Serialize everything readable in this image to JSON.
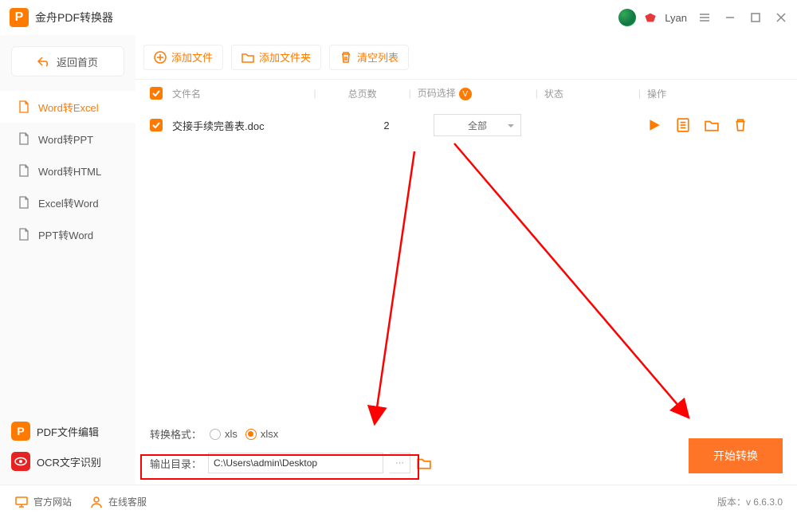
{
  "app": {
    "title": "金舟PDF转换器",
    "username": "Lyan"
  },
  "sidebar": {
    "back": "返回首页",
    "items": [
      {
        "label": "Word转Excel"
      },
      {
        "label": "Word转PPT"
      },
      {
        "label": "Word转HTML"
      },
      {
        "label": "Excel转Word"
      },
      {
        "label": "PPT转Word"
      }
    ],
    "tools": [
      {
        "label": "PDF文件编辑"
      },
      {
        "label": "OCR文字识别"
      }
    ]
  },
  "toolbar": {
    "add_file": "添加文件",
    "add_folder": "添加文件夹",
    "clear": "清空列表"
  },
  "columns": {
    "name": "文件名",
    "pages": "总页数",
    "select": "页码选择",
    "status": "状态",
    "action": "操作"
  },
  "rows": [
    {
      "name": "交接手续完善表.doc",
      "pages": "2",
      "select": "全部"
    }
  ],
  "bottom": {
    "format_label": "转换格式：",
    "opt1": "xls",
    "opt2": "xlsx",
    "output_label": "输出目录：",
    "path": "C:\\Users\\admin\\Desktop",
    "more": "···",
    "start": "开始转换"
  },
  "footer": {
    "site": "官方网站",
    "support": "在线客服",
    "version_label": "版本：",
    "version": "v 6.6.3.0"
  }
}
